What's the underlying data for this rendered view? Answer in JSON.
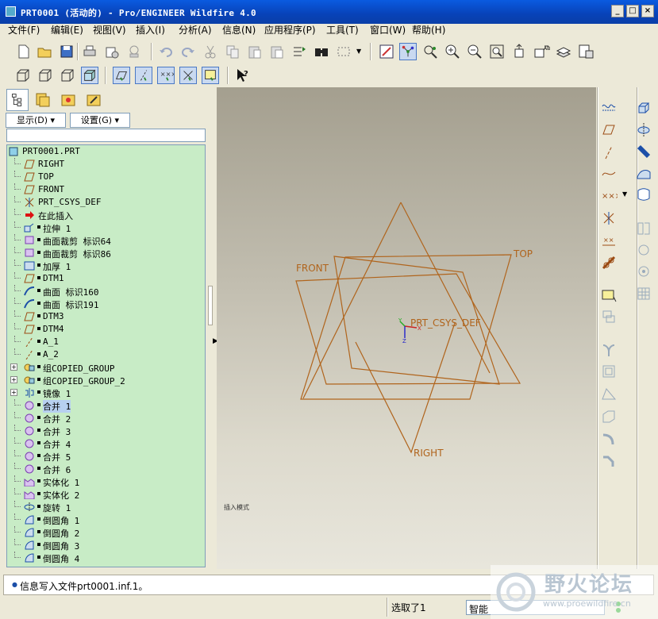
{
  "window": {
    "title": "PRT0001 (活动的) - Pro/ENGINEER Wildfire 4.0"
  },
  "menus": [
    "文件(F)",
    "编辑(E)",
    "视图(V)",
    "插入(I)",
    "分析(A)",
    "信息(N)",
    "应用程序(P)",
    "工具(T)",
    "窗口(W)",
    "帮助(H)"
  ],
  "navigator": {
    "show_label": "显示(D)",
    "settings_label": "设置(G)"
  },
  "tree": {
    "root": "PRT0001.PRT",
    "items": [
      {
        "label": "RIGHT",
        "icon": "datum-plane-icon"
      },
      {
        "label": "TOP",
        "icon": "datum-plane-icon"
      },
      {
        "label": "FRONT",
        "icon": "datum-plane-icon"
      },
      {
        "label": "PRT_CSYS_DEF",
        "icon": "csys-icon"
      },
      {
        "label": "在此插入",
        "icon": "insert-arrow-icon"
      },
      {
        "label": "拉伸 1",
        "icon": "extrude-icon"
      },
      {
        "label": "曲面裁剪 标识64",
        "icon": "surface-trim-icon"
      },
      {
        "label": "曲面裁剪 标识86",
        "icon": "surface-trim-icon"
      },
      {
        "label": "加厚 1",
        "icon": "thicken-icon"
      },
      {
        "label": "DTM1",
        "icon": "datum-plane-icon"
      },
      {
        "label": "曲面 标识160",
        "icon": "surface-icon"
      },
      {
        "label": "曲面 标识191",
        "icon": "surface-icon"
      },
      {
        "label": "DTM3",
        "icon": "datum-plane-icon"
      },
      {
        "label": "DTM4",
        "icon": "datum-plane-icon"
      },
      {
        "label": "A_1",
        "icon": "axis-icon"
      },
      {
        "label": "A_2",
        "icon": "axis-icon"
      },
      {
        "label": "组COPIED_GROUP",
        "icon": "group-icon",
        "expand": "+"
      },
      {
        "label": "组COPIED_GROUP_2",
        "icon": "group-icon",
        "expand": "+"
      },
      {
        "label": "镜像 1",
        "icon": "mirror-icon",
        "expand": "+"
      },
      {
        "label": "合并 1",
        "icon": "merge-icon",
        "selected": true
      },
      {
        "label": "合并 2",
        "icon": "merge-icon"
      },
      {
        "label": "合并 3",
        "icon": "merge-icon"
      },
      {
        "label": "合并 4",
        "icon": "merge-icon"
      },
      {
        "label": "合并 5",
        "icon": "merge-icon"
      },
      {
        "label": "合并 6",
        "icon": "merge-icon"
      },
      {
        "label": "实体化 1",
        "icon": "solidify-icon"
      },
      {
        "label": "实体化 2",
        "icon": "solidify-icon"
      },
      {
        "label": "旋转 1",
        "icon": "revolve-icon"
      },
      {
        "label": "倒圆角 1",
        "icon": "round-icon"
      },
      {
        "label": "倒圆角 2",
        "icon": "round-icon"
      },
      {
        "label": "倒圆角 3",
        "icon": "round-icon"
      },
      {
        "label": "倒圆角 4",
        "icon": "round-icon"
      }
    ]
  },
  "canvas": {
    "labels": {
      "front": "FRONT",
      "top": "TOP",
      "right": "RIGHT",
      "csys": "PRT_CSYS_DEF"
    },
    "small_text": "插入模式",
    "datum_color": "#b0641c"
  },
  "status": {
    "message": "信息写入文件prt0001.inf.1。",
    "selected": "选取了1",
    "filter": "智能"
  },
  "watermark": {
    "text": "野火论坛",
    "url": "www.proewildfire.cn"
  }
}
